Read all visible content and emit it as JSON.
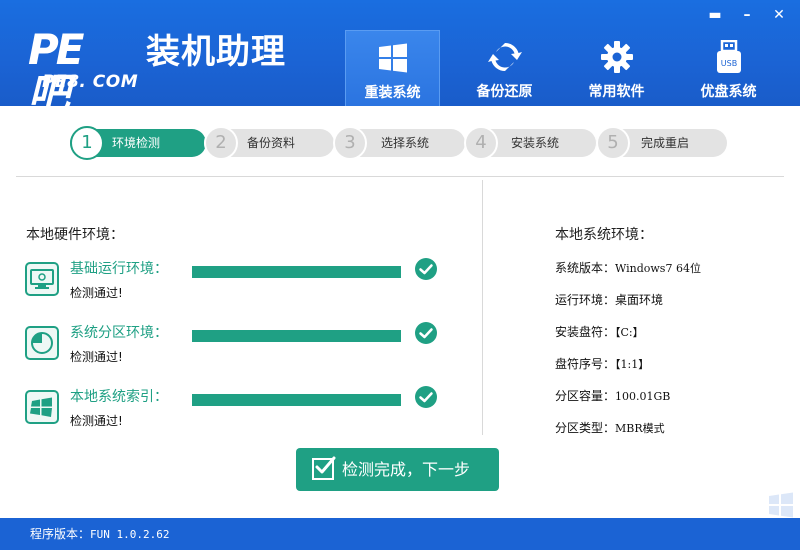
{
  "logo": {
    "pe": "PE吧",
    "name": "装机助理",
    "sub": "PE8. COM"
  },
  "window_controls": {
    "minimize": "▬",
    "restore": "–",
    "close": "✕"
  },
  "nav": [
    {
      "label": "重装系统",
      "icon": "windows-icon",
      "active": true
    },
    {
      "label": "备份还原",
      "icon": "sync-icon",
      "active": false
    },
    {
      "label": "常用软件",
      "icon": "gear-icon",
      "active": false
    },
    {
      "label": "优盘系统",
      "icon": "usb-icon",
      "active": false,
      "icon_text": "USB"
    }
  ],
  "steps": [
    {
      "num": "1",
      "label": "环境检测",
      "active": true
    },
    {
      "num": "2",
      "label": "备份资料",
      "active": false
    },
    {
      "num": "3",
      "label": "选择系统",
      "active": false
    },
    {
      "num": "4",
      "label": "安装系统",
      "active": false
    },
    {
      "num": "5",
      "label": "完成重启",
      "active": false
    }
  ],
  "hardware": {
    "title": "本地硬件环境：",
    "items": [
      {
        "name": "基础运行环境：",
        "status": "检测通过!",
        "icon": "monitor-icon",
        "progress": 1.0
      },
      {
        "name": "系统分区环境：",
        "status": "检测通过!",
        "icon": "pie-chart-icon",
        "progress": 1.0
      },
      {
        "name": "本地系统索引：",
        "status": "检测通过!",
        "icon": "windows-logo-icon",
        "progress": 1.0
      }
    ]
  },
  "system": {
    "title": "本地系统环境：",
    "rows": [
      {
        "label": "系统版本：",
        "value": "Windows7  64位"
      },
      {
        "label": "运行环境：",
        "value": "桌面环境"
      },
      {
        "label": "安装盘符：",
        "value": "【C:】"
      },
      {
        "label": "盘符序号：",
        "value": "【1:1】"
      },
      {
        "label": "分区容量：",
        "value": "100.01GB"
      },
      {
        "label": "分区类型：",
        "value": "MBR模式"
      }
    ]
  },
  "next_button": {
    "label": "检测完成，下一步"
  },
  "footer": {
    "version_label": "程序版本：",
    "version": "FUN 1.0.2.62"
  },
  "colors": {
    "header_blue": "#1b63d4",
    "accent_green": "#1fa084",
    "step_gray": "#e3e3e3"
  }
}
